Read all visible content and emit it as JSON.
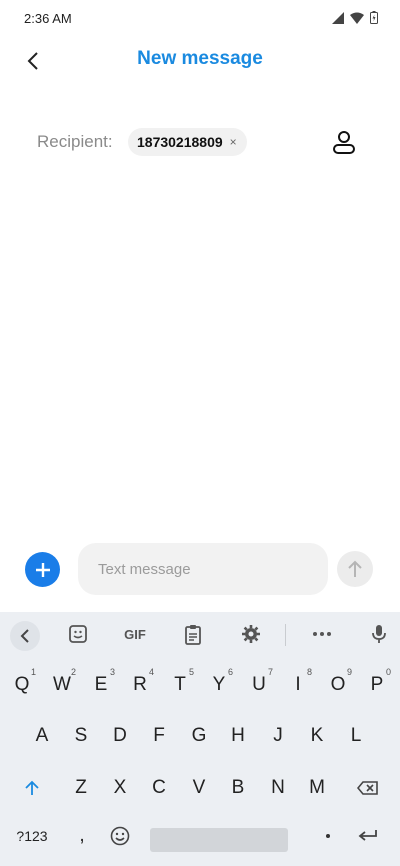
{
  "status_bar": {
    "time": "2:36 AM"
  },
  "header": {
    "title": "New message"
  },
  "recipient": {
    "label": "Recipient:",
    "chip_number": "18730218809",
    "chip_close": "×"
  },
  "compose": {
    "placeholder": "Text message"
  },
  "colors": {
    "accent": "#1a8ae0",
    "add_button": "#1a7de8",
    "shift_arrow": "#1a8ae0"
  },
  "keyboard": {
    "toolbar": {
      "gif_label": "GIF"
    },
    "row1": [
      {
        "label": "Q",
        "hint": "1"
      },
      {
        "label": "W",
        "hint": "2"
      },
      {
        "label": "E",
        "hint": "3"
      },
      {
        "label": "R",
        "hint": "4"
      },
      {
        "label": "T",
        "hint": "5"
      },
      {
        "label": "Y",
        "hint": "6"
      },
      {
        "label": "U",
        "hint": "7"
      },
      {
        "label": "I",
        "hint": "8"
      },
      {
        "label": "O",
        "hint": "9"
      },
      {
        "label": "P",
        "hint": "0"
      }
    ],
    "row2": [
      "A",
      "S",
      "D",
      "F",
      "G",
      "H",
      "J",
      "K",
      "L"
    ],
    "row3": [
      "Z",
      "X",
      "C",
      "V",
      "B",
      "N",
      "M"
    ],
    "bottom": {
      "symbols_label": "?123",
      "comma_label": ","
    }
  }
}
